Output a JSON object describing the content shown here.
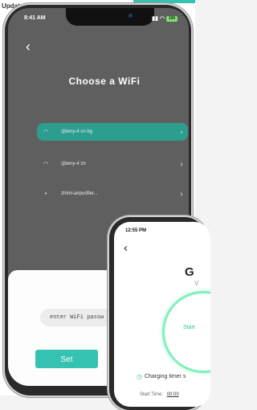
{
  "background_app": {
    "update_label": "Update"
  },
  "phone1": {
    "status": {
      "time": "8:41 AM",
      "battery": "100"
    },
    "title": "Choose a WiFi",
    "networks": [
      {
        "name": "zjbeny-4 cn bg",
        "selected": true
      },
      {
        "name": "zjbeny-4 zn",
        "selected": false
      },
      {
        "name": "zhimi-airpurifier...",
        "selected": false
      }
    ],
    "password_placeholder": "enter WiFi passw",
    "set_label": "Set"
  },
  "phone2": {
    "status": {
      "time": "12:55 PM"
    },
    "title_fragment": "G",
    "version_fragment": "V",
    "start_label": "Start",
    "charging_label": "Charging timer s",
    "start_time_label": "Start Time:",
    "start_time_value": "00:00"
  },
  "colors": {
    "accent": "#36c2b0",
    "ring": "#7ff0b8"
  }
}
